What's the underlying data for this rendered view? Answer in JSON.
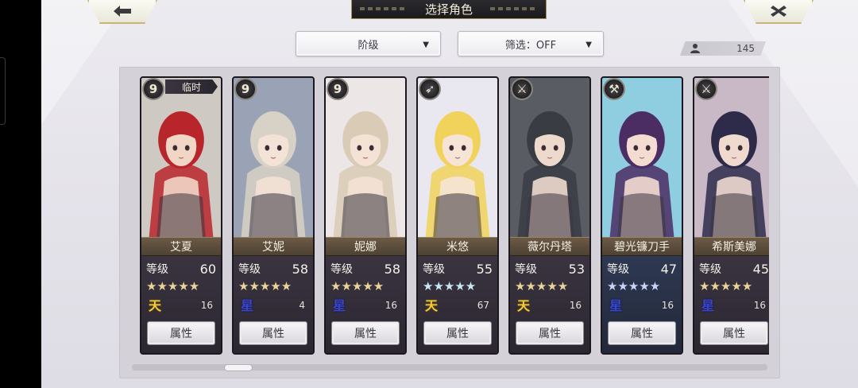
{
  "header": {
    "title": "选择角色",
    "back_icon": "back-arrow-icon",
    "close_icon": "close-x-icon"
  },
  "filters": {
    "sort_label": "阶级",
    "filter_label": "筛选：OFF"
  },
  "roster_count": "145",
  "level_label": "等级",
  "attribute_label": "属性",
  "characters": [
    {
      "name": "艾夏",
      "level": "60",
      "class_icon": "9",
      "temp_tag": "临时",
      "stars": "★★★★★",
      "star_color": "gold",
      "grade": "天",
      "grade_color": "gold",
      "count": "16",
      "theme": "dark",
      "hair": "#b8262c",
      "skin": "#f1d6c6",
      "bg": "#cfc9c4"
    },
    {
      "name": "艾妮",
      "level": "58",
      "class_icon": "9",
      "temp_tag": "",
      "stars": "★★★★★",
      "star_color": "gold",
      "grade": "星",
      "grade_color": "blue",
      "count": "4",
      "theme": "dark",
      "hair": "#d8d2c6",
      "skin": "#f3e2d6",
      "bg": "#9aa3b6"
    },
    {
      "name": "妮娜",
      "level": "58",
      "class_icon": "9",
      "temp_tag": "",
      "stars": "★★★★★",
      "star_color": "gold",
      "grade": "星",
      "grade_color": "blue",
      "count": "16",
      "theme": "dark",
      "hair": "#d9cbb5",
      "skin": "#f4e2d4",
      "bg": "#ece6e6"
    },
    {
      "name": "米悠",
      "level": "55",
      "class_icon": "➶",
      "temp_tag": "",
      "stars": "★★★★★",
      "star_color": "silver",
      "grade": "天",
      "grade_color": "gold",
      "count": "67",
      "theme": "dark",
      "hair": "#f1d25a",
      "skin": "#f6e4d6",
      "bg": "#e9e7ef"
    },
    {
      "name": "薇尔丹塔",
      "level": "53",
      "class_icon": "⚔",
      "temp_tag": "",
      "stars": "★★★★★",
      "star_color": "gold",
      "grade": "天",
      "grade_color": "gold",
      "count": "16",
      "theme": "dark",
      "hair": "#3a3c44",
      "skin": "#eed9cd",
      "bg": "#5a5c63"
    },
    {
      "name": "碧光镰刀手",
      "level": "47",
      "class_icon": "⚒",
      "temp_tag": "",
      "stars": "★★★★★",
      "star_color": "blue",
      "grade": "星",
      "grade_color": "blue",
      "count": "16",
      "theme": "blue",
      "hair": "#4b2d63",
      "skin": "#f4dcd2",
      "bg": "#8fcde0"
    },
    {
      "name": "希斯美娜",
      "level": "45",
      "class_icon": "⚔",
      "temp_tag": "",
      "stars": "★★★★★",
      "star_color": "gold",
      "grade": "星",
      "grade_color": "blue",
      "count": "16",
      "theme": "dark",
      "hair": "#2d2a4a",
      "skin": "#f0d9cf",
      "bg": "#c9b9c7"
    }
  ]
}
